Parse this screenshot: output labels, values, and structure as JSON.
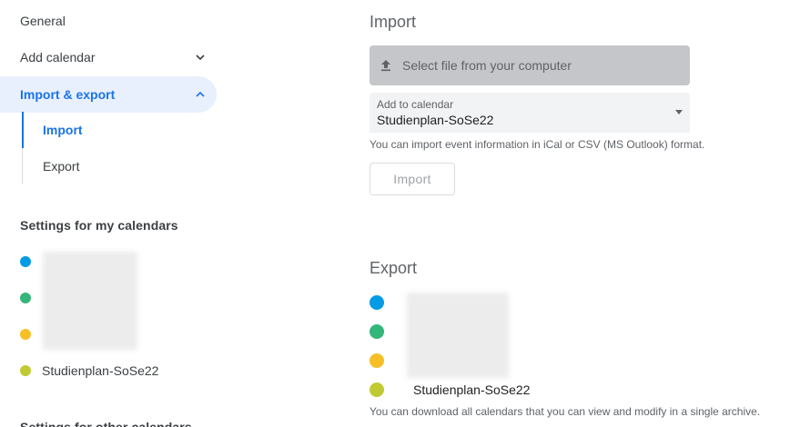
{
  "sidebar": {
    "general": "General",
    "add_calendar": "Add calendar",
    "import_export": "Import & export",
    "sub_items": {
      "import": "Import",
      "export": "Export"
    },
    "my_calendars_title": "Settings for my calendars",
    "my_calendars": [
      {
        "color": "#039be5",
        "label": ""
      },
      {
        "color": "#33b679",
        "label": ""
      },
      {
        "color": "#f6bf26",
        "label": ""
      },
      {
        "color": "#c0ca33",
        "label": "Studienplan-SoSe22"
      }
    ],
    "other_calendars_title": "Settings for other calendars"
  },
  "import": {
    "title": "Import",
    "file_button": "Select file from your computer",
    "add_to_label": "Add to calendar",
    "add_to_value": "Studienplan-SoSe22",
    "hint": "You can import event information in iCal or CSV (MS Outlook) format.",
    "import_button": "Import"
  },
  "export": {
    "title": "Export",
    "calendars": [
      {
        "color": "#039be5",
        "label": ""
      },
      {
        "color": "#33b679",
        "label": ""
      },
      {
        "color": "#f6bf26",
        "label": ""
      },
      {
        "color": "#c0ca33",
        "label": "Studienplan-SoSe22"
      }
    ],
    "hint": "You can download all calendars that you can view and modify in a single archive."
  },
  "colors": {
    "accent": "#1a73e8",
    "active_bg": "#e8f0fe"
  }
}
